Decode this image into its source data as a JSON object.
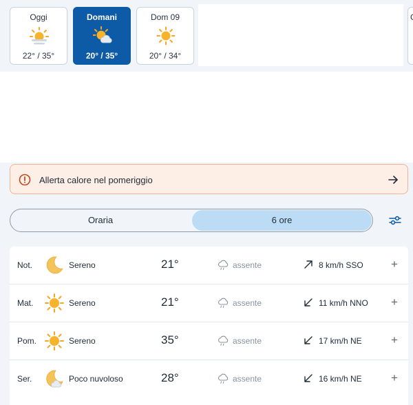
{
  "days": [
    {
      "name": "Oggi",
      "temps": "22° / 35°",
      "icon": "sun-haze-icon",
      "selected": false
    },
    {
      "name": "Domani",
      "temps": "20° / 35°",
      "icon": "sun-cloud-icon",
      "selected": true
    },
    {
      "name": "Dom 09",
      "temps": "20° / 34°",
      "icon": "sun-icon",
      "selected": false
    }
  ],
  "edge_day": {
    "name": "G"
  },
  "alert": {
    "text": "Allerta calore nel pomeriggio",
    "icon": "warning-circle-icon",
    "arrow": "arrow-right-icon",
    "color": "#f2b393"
  },
  "segment": {
    "left": "Oraria",
    "right": "6 ore",
    "active": "6 ore"
  },
  "filter_icon": "settings-sliders-icon",
  "rows": [
    {
      "period": "Not.",
      "icon": "moon-icon",
      "condition": "Sereno",
      "temp": "21°",
      "rain": "assente",
      "wind_dir": "arrow-up-right-icon",
      "wind": "8 km/h SSO"
    },
    {
      "period": "Mat.",
      "icon": "sun-icon",
      "condition": "Sereno",
      "temp": "21°",
      "rain": "assente",
      "wind_dir": "arrow-down-left-icon",
      "wind": "11 km/h NNO"
    },
    {
      "period": "Pom.",
      "icon": "sun-icon",
      "condition": "Sereno",
      "temp": "35°",
      "rain": "assente",
      "wind_dir": "arrow-down-left-icon",
      "wind": "17 km/h NE"
    },
    {
      "period": "Ser.",
      "icon": "moon-cloud-icon",
      "condition": "Poco nuvoloso",
      "temp": "28°",
      "rain": "assente",
      "wind_dir": "arrow-down-left-icon",
      "wind": "16 km/h NE"
    }
  ],
  "colors": {
    "accent": "#0d5aa6",
    "segment_active": "#bcdcf6",
    "sun": "#f5a623",
    "moon": "#f4c45a"
  }
}
